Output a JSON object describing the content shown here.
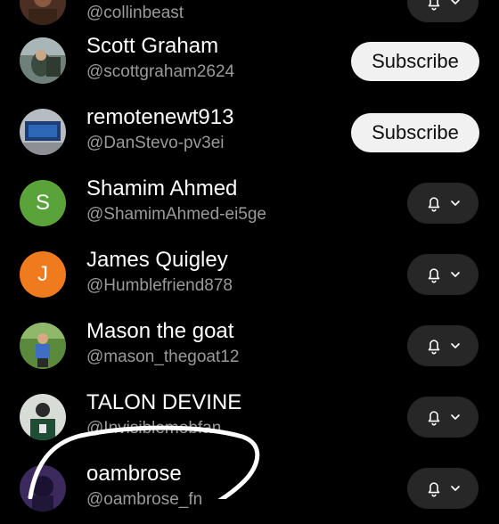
{
  "colors": {
    "background": "#000000",
    "subscribe_bg": "#f1f1f1",
    "bell_bg": "#272727",
    "handle_text": "#9a9a9a",
    "avatar_green": "#5aa33a",
    "avatar_orange": "#f07a1e"
  },
  "channels": [
    {
      "name": "",
      "handle": "@collinbeast",
      "avatar": "photo",
      "action": "bell"
    },
    {
      "name": "Scott Graham",
      "handle": "@scottgraham2624",
      "avatar": "photo",
      "action": "Subscribe"
    },
    {
      "name": "remotenewt913",
      "handle": "@DanStevo-pv3ei",
      "avatar": "photo",
      "action": "Subscribe"
    },
    {
      "name": "Shamim Ahmed",
      "handle": "@ShamimAhmed-ei5ge",
      "avatar": "S",
      "action": "bell"
    },
    {
      "name": "James Quigley",
      "handle": "@Humblefriend878",
      "avatar": "J",
      "action": "bell"
    },
    {
      "name": "Mason the goat",
      "handle": "@mason_thegoat12",
      "avatar": "photo",
      "action": "bell"
    },
    {
      "name": "TALON DEVINE",
      "handle": "@Invisiblemobfan",
      "avatar": "photo",
      "action": "bell"
    },
    {
      "name": "oambrose",
      "handle": "@oambrose_fn",
      "avatar": "photo",
      "action": "bell"
    }
  ],
  "icons": {
    "notification": "bell-icon",
    "dropdown": "chevron-down-icon"
  }
}
